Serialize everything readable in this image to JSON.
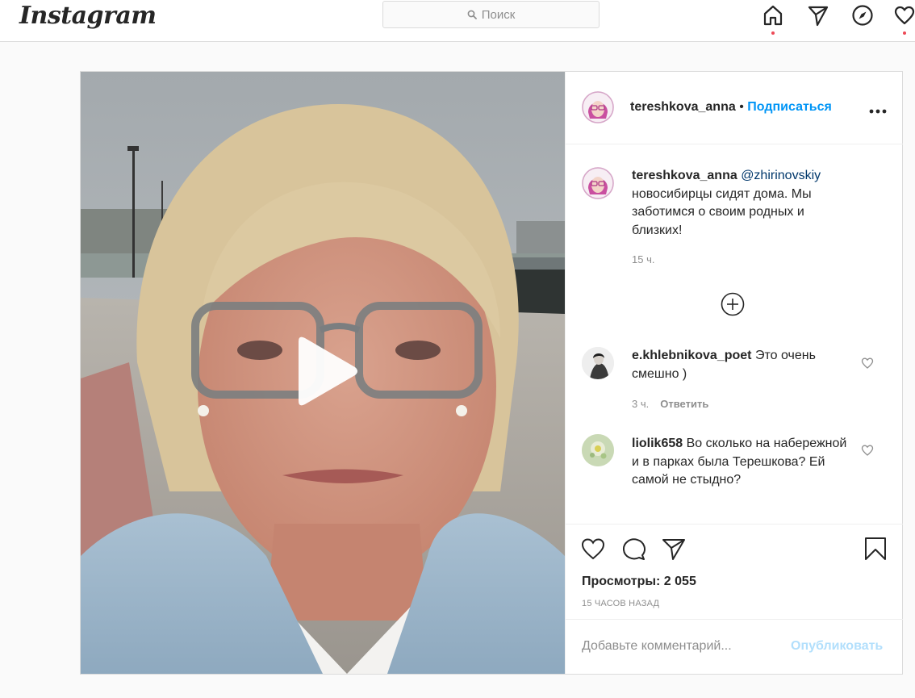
{
  "app": {
    "logo": "Instagram",
    "search_placeholder": "Поиск"
  },
  "nav": {
    "icons": [
      "home-icon",
      "direct-icon",
      "explore-icon",
      "activity-icon"
    ]
  },
  "post": {
    "author": "tereshkova_anna",
    "separator": "•",
    "follow_label": "Подписаться",
    "more_label": "•••",
    "caption": {
      "author": "tereshkova_anna",
      "mention": "@zhirinovskiy",
      "text": "новосибирцы сидят дома. Мы заботимся о своим родных и близких!",
      "time": "15 ч."
    },
    "comments": [
      {
        "user": "e.khlebnikova_poet",
        "text": "Это очень смешно )",
        "time": "3 ч.",
        "reply_label": "Ответить"
      },
      {
        "user": "liolik658",
        "text": "Во сколько на набережной и в парках была Терешкова? Ей самой не стыдно?"
      }
    ],
    "views_label": "Просмотры:",
    "views_count": "2 055",
    "timestamp": "15 ЧАСОВ НАЗАД",
    "comment_placeholder": "Добавьте комментарий...",
    "publish_label": "Опубликовать"
  },
  "colors": {
    "link_blue": "#0095f6",
    "publish_disabled": "#b2dffc",
    "notification_dot": "#ed4956"
  }
}
